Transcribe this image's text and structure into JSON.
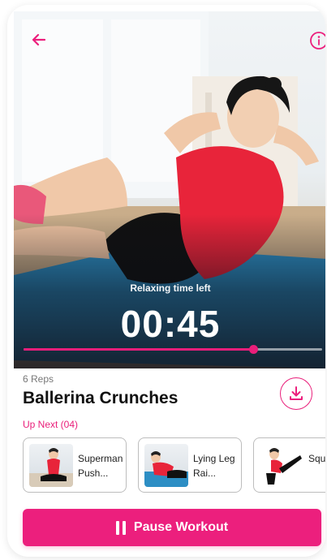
{
  "player": {
    "timer_label": "Relaxing time left",
    "time_left": "00:45",
    "progress": 0.77
  },
  "exercise": {
    "reps": "6 Reps",
    "title": "Ballerina Crunches"
  },
  "up_next": {
    "label": "Up Next (04)",
    "items": [
      {
        "name": "Superman Push..."
      },
      {
        "name": "Lying Leg Rai..."
      },
      {
        "name": "Squat Kick"
      }
    ]
  },
  "controls": {
    "pause_label": "Pause Workout"
  },
  "icons": {
    "back": "arrow-left-icon",
    "info": "info-icon",
    "download": "download-icon",
    "pause": "pause-icon"
  },
  "colors": {
    "accent": "#ec1f7d",
    "text": "#111111",
    "muted": "#777777"
  }
}
